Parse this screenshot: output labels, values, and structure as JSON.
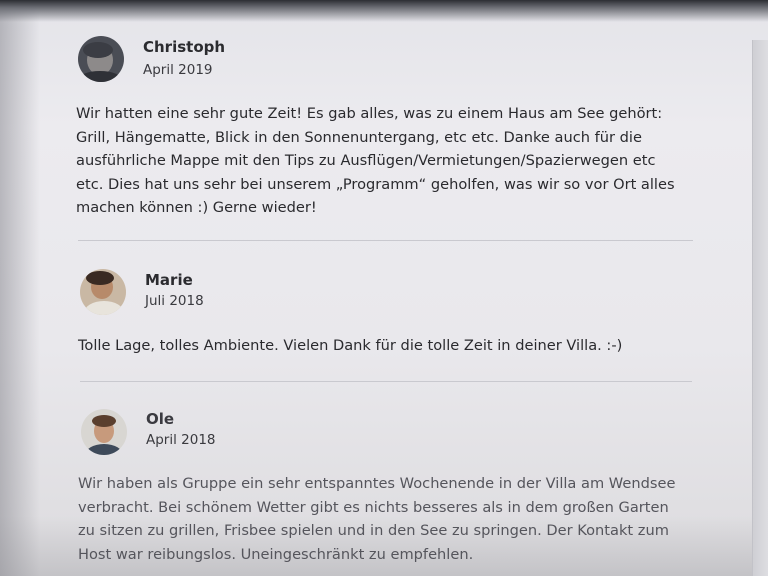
{
  "reviews": [
    {
      "name": "Christoph",
      "date": "April 2019",
      "lines": [
        "Wir hatten eine sehr gute Zeit! Es gab alles, was zu einem Haus am See gehört:",
        "Grill, Hängematte, Blick in den Sonnenuntergang, etc etc. Danke auch für die",
        "ausführliche Mappe mit den Tips zu Ausflügen/Vermietungen/Spazierwegen etc",
        "etc. Dies hat uns sehr bei unserem „Programm“ geholfen, was wir so vor Ort alles",
        "machen können :) Gerne wieder!"
      ]
    },
    {
      "name": "Marie",
      "date": "Juli 2018",
      "lines": [
        "Tolle Lage, tolles Ambiente. Vielen Dank für die tolle Zeit in deiner Villa. :-)"
      ]
    },
    {
      "name": "Ole",
      "date": "April 2018",
      "lines": [
        "Wir haben als Gruppe ein sehr entspanntes Wochenende in der Villa am Wendsee",
        "verbracht. Bei schönem Wetter gibt es nichts besseres als in dem großen Garten",
        "zu sitzen zu grillen, Frisbee spielen und in den See zu springen. Der Kontakt zum",
        "Host war reibungslos. Uneingeschränkt zu empfehlen."
      ]
    }
  ]
}
